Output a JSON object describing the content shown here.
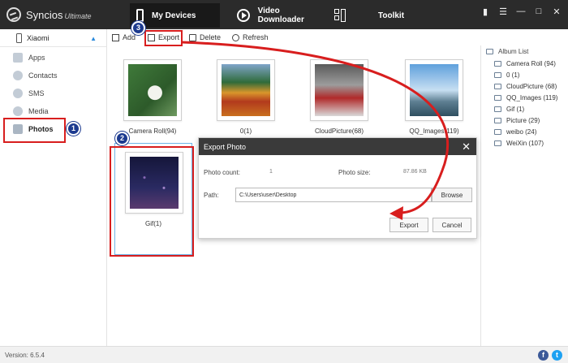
{
  "app": {
    "name": "Syncios",
    "edition": "Ultimate"
  },
  "tabs": [
    {
      "label": "My Devices",
      "icon": "phone-icon",
      "active": true
    },
    {
      "label": "Video Downloader",
      "icon": "play-icon"
    },
    {
      "label": "Toolkit",
      "icon": "grid-icon"
    }
  ],
  "window_controls": [
    "chat-icon",
    "menu-icon",
    "minimize-icon",
    "maximize-icon",
    "close-icon"
  ],
  "device": {
    "name": "Xiaomi"
  },
  "sidebar": {
    "items": [
      {
        "label": "Apps",
        "icon": "apps-icon"
      },
      {
        "label": "Contacts",
        "icon": "contacts-icon"
      },
      {
        "label": "SMS",
        "icon": "sms-icon"
      },
      {
        "label": "Media",
        "icon": "media-icon"
      },
      {
        "label": "Photos",
        "icon": "photos-icon",
        "active": true
      }
    ]
  },
  "toolbar": {
    "add_label": "Add",
    "export_label": "Export",
    "delete_label": "Delete",
    "refresh_label": "Refresh"
  },
  "albums": [
    {
      "label": "Camera Roll(94)"
    },
    {
      "label": "0(1)"
    },
    {
      "label": "CloudPicture(68)"
    },
    {
      "label": "QQ_Images(119)"
    },
    {
      "label": "Gif(1)",
      "selected": true
    }
  ],
  "album_list": {
    "title": "Album List",
    "items": [
      "Camera Roll (94)",
      "0 (1)",
      "CloudPicture (68)",
      "QQ_Images (119)",
      "Gif (1)",
      "Picture (29)",
      "weibo (24)",
      "WeiXin (107)"
    ]
  },
  "dialog": {
    "title": "Export Photo",
    "photo_count_label": "Photo count:",
    "photo_count": "1",
    "photo_size_label": "Photo size:",
    "photo_size": "87.86 KB",
    "path_label": "Path:",
    "path_value": "C:\\Users\\user\\Desktop",
    "browse_label": "Browse",
    "export_label": "Export",
    "cancel_label": "Cancel"
  },
  "steps": [
    "1",
    "2",
    "3"
  ],
  "status": {
    "version": "Version: 6.5.4"
  },
  "social": {
    "facebook": "f",
    "twitter": "t"
  },
  "colors": {
    "highlight": "#d81e1e",
    "badge": "#1c3a8f",
    "titlebar": "#2b2b2b",
    "accent": "#2a8adc"
  }
}
